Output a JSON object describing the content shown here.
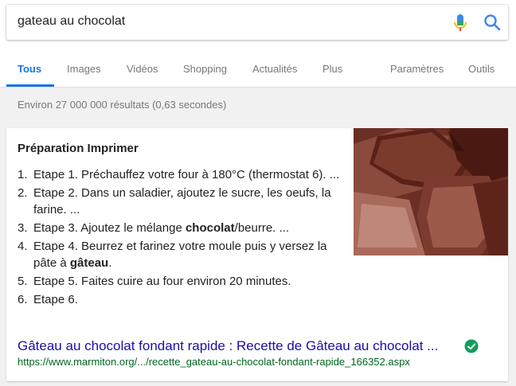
{
  "search": {
    "query": "gateau au chocolat"
  },
  "tabs": [
    {
      "label": "Tous"
    },
    {
      "label": "Images"
    },
    {
      "label": "Vidéos"
    },
    {
      "label": "Shopping"
    },
    {
      "label": "Actualités"
    },
    {
      "label": "Plus"
    },
    {
      "label": "Paramètres"
    },
    {
      "label": "Outils"
    }
  ],
  "stats": "Environ 27 000 000 résultats (0,63 secondes)",
  "snippet": {
    "heading": "Préparation Imprimer",
    "steps": [
      {
        "num": "1.",
        "text": "Etape 1. Préchauffez votre four à 180°C (thermostat 6). ..."
      },
      {
        "num": "2.",
        "text": "Etape 2. Dans un saladier, ajoutez le sucre, les oeufs, la farine. ..."
      },
      {
        "num": "3.",
        "pre": "Etape 3. Ajoutez le mélange ",
        "bold": "chocolat",
        "post": "/beurre. ..."
      },
      {
        "num": "4.",
        "pre": "Etape 4. Beurrez et farinez votre moule puis y versez la pâte à ",
        "bold": "gâteau",
        "post": "."
      },
      {
        "num": "5.",
        "text": "Etape 5. Faites cuire au four environ 20 minutes."
      },
      {
        "num": "6.",
        "text": "Etape 6."
      }
    ],
    "result_title": "Gâteau au chocolat fondant rapide : Recette de Gâteau au chocolat ...",
    "result_url": "https://www.marmiton.org/.../recette_gateau-au-chocolat-fondant-rapide_166352.aspx"
  },
  "icons": {
    "mic": "microphone-icon",
    "search": "search-icon",
    "verified": "verified-check-icon"
  },
  "colors": {
    "accent": "#1a73e8",
    "link": "#1a0dab",
    "url": "#006621",
    "verified": "#0f9d58"
  }
}
